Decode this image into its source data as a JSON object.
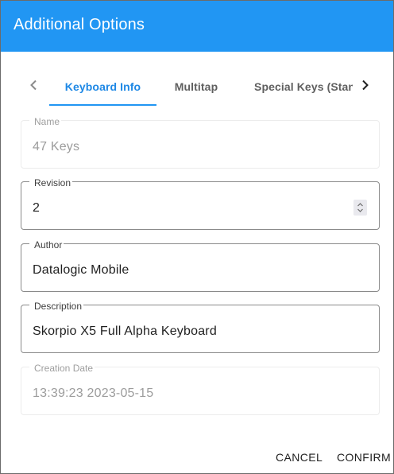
{
  "dialog": {
    "title": "Additional Options"
  },
  "tabs": {
    "items": [
      {
        "label": "Keyboard Info"
      },
      {
        "label": "Multitap"
      },
      {
        "label": "Special Keys (Standard)"
      }
    ]
  },
  "fields": {
    "name": {
      "label": "Name",
      "value": "47 Keys"
    },
    "revision": {
      "label": "Revision",
      "value": "2"
    },
    "author": {
      "label": "Author",
      "value": "Datalogic Mobile"
    },
    "description": {
      "label": "Description",
      "value": "Skorpio X5 Full Alpha Keyboard"
    },
    "creation_date": {
      "label": "Creation Date",
      "value": "13:39:23 2023-05-15"
    }
  },
  "actions": {
    "cancel": "CANCEL",
    "confirm": "CONFIRM"
  },
  "colors": {
    "header": "#2196f3",
    "active_tab": "#1e88e5"
  }
}
